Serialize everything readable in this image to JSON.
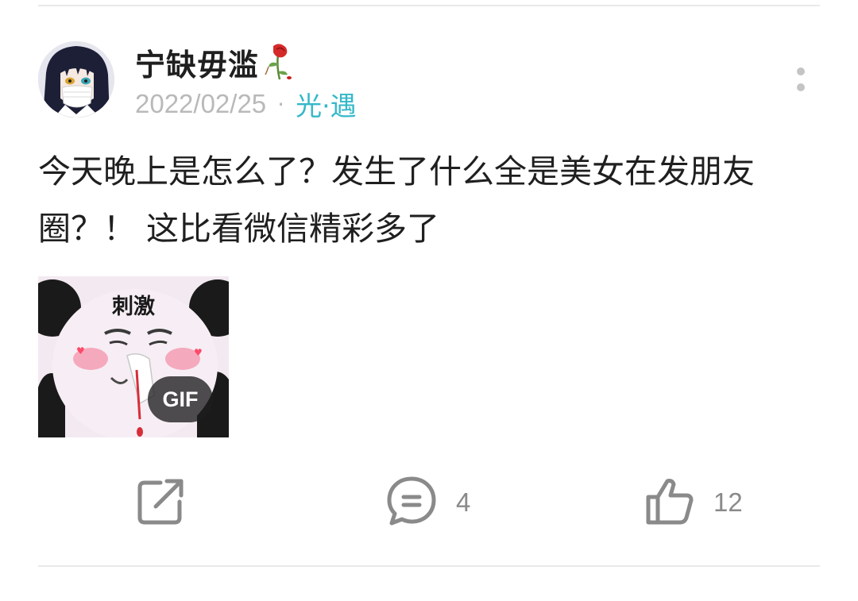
{
  "post": {
    "username": "宁缺毋滥",
    "date": "2022/02/25",
    "separator": "·",
    "source": "光·遇",
    "text": "今天晚上是怎么了？发生了什么全是美女在发朋友圈？！ 这比看微信精彩多了",
    "image": {
      "caption": "刺激",
      "badge": "GIF"
    }
  },
  "actions": {
    "share_icon": "share-icon",
    "comment_icon": "comment-icon",
    "comment_count": "4",
    "like_icon": "thumbs-up-icon",
    "like_count": "12"
  },
  "colors": {
    "accent": "#35b8c9",
    "muted": "#b9b9b9",
    "icon": "#8a8a8a"
  }
}
